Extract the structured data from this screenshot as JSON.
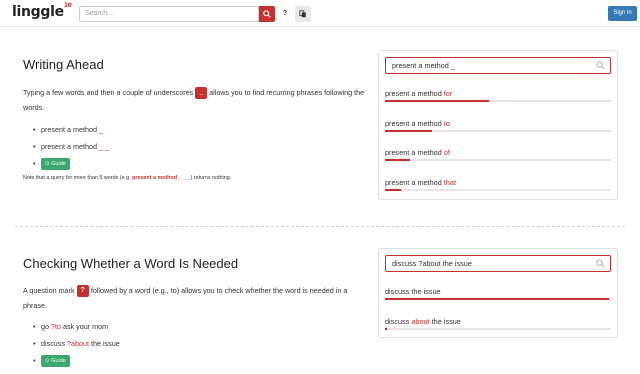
{
  "header": {
    "logo": "linggle",
    "logo_sup": "10",
    "search_placeholder": "Search...",
    "help_label": "?",
    "signin_label": "Sign in"
  },
  "sections": [
    {
      "title": "Writing Ahead",
      "para_before": "Typing a few words and then a couple of underscores ",
      "tag": "_",
      "para_after": " allows you to find recurring phrases following the words.",
      "bullets": [
        {
          "text": "present a method ",
          "red": "_"
        },
        {
          "text": "present a method ",
          "red": "_ _"
        }
      ],
      "guide_label": "Guide",
      "note_before": "Note that a query for more than 5 words (e.g. ",
      "note_bold": "present a method _ _ _",
      "note_after": ") returns nothing.",
      "demo": {
        "query": "present a method _",
        "results": [
          {
            "text": "present a method ",
            "red": "for",
            "fill": 0.46
          },
          {
            "text": "present a method ",
            "red": "to",
            "fill": 0.21
          },
          {
            "text": "present a method ",
            "red": "of",
            "fill": 0.11
          },
          {
            "text": "present a method ",
            "red": "that",
            "fill": 0.07
          }
        ]
      }
    },
    {
      "title": "Checking Whether a Word Is Needed",
      "para_before": "A question mark ",
      "tag": "?",
      "para_after": " followed by a word (e.g., to) allows you to check whether the word is needed in a phrase.",
      "bullets": [
        {
          "text_pre": "go ",
          "red": "?to",
          "text_post": " ask your mom"
        },
        {
          "text_pre": "discuss ",
          "red": "?about",
          "text_post": " the issue"
        }
      ],
      "guide_label": "Guide",
      "demo": {
        "query": "discuss ?about the issue",
        "results": [
          {
            "pre": "discuss the issue",
            "red": "",
            "post": "",
            "fill": 0.99
          },
          {
            "pre": "discuss ",
            "red": "about",
            "post": " the issue",
            "fill": 0.01
          }
        ]
      }
    }
  ],
  "colors": {
    "accent": "#c9302c",
    "guide": "#3aa76d",
    "signin": "#337ab7"
  }
}
